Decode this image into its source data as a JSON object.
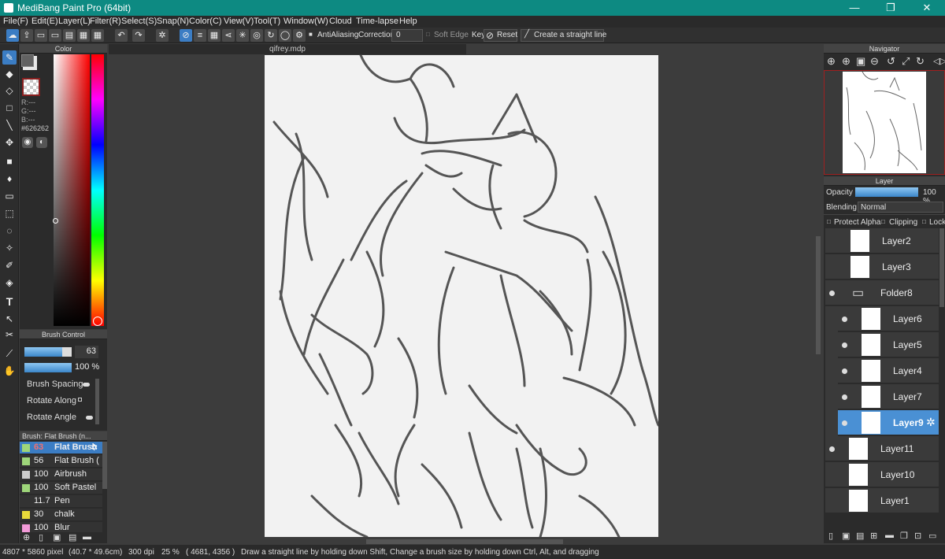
{
  "window": {
    "title": "MediBang Paint Pro (64bit)",
    "minimize": "—",
    "maximize": "❐",
    "close": "✕"
  },
  "menu": [
    "File(F)",
    "Edit(E)",
    "Layer(L)",
    "Filter(R)",
    "Select(S)",
    "Snap(N)",
    "Color(C)",
    "View(V)",
    "Tool(T)",
    "Window(W)",
    "Cloud",
    "Time-lapse",
    "Help"
  ],
  "toolbar": {
    "antialiasing": "AntiAliasing",
    "correction_label": "Correction",
    "correction_value": "0",
    "soft_edge": "Soft Edge",
    "key": "Key",
    "reset": "Reset",
    "straight_line": "Create a straight line"
  },
  "color_panel": {
    "title": "Color",
    "r": "R:---",
    "g": "G:---",
    "b": "B:---",
    "hex": "#626262",
    "main_color": "#626262"
  },
  "brush_control": {
    "title": "Brush Control",
    "size": "63",
    "opacity": "100 %",
    "spacing": "Brush Spacing",
    "rotate_along": "Rotate Along",
    "rotate_angle": "Rotate Angle"
  },
  "brush_list": {
    "title": "Brush: Flat Brush (n...",
    "items": [
      {
        "size": "63",
        "name": "Flat Brush",
        "color": "#9ed67a"
      },
      {
        "size": "56",
        "name": "Flat Brush (",
        "color": "#9ed67a"
      },
      {
        "size": "100",
        "name": "Airbrush",
        "color": "#cccccc"
      },
      {
        "size": "100",
        "name": "Soft Pastel",
        "color": "#9ed67a"
      },
      {
        "size": "11.7",
        "name": "Pen",
        "color": "#333333"
      },
      {
        "size": "30",
        "name": "chalk",
        "color": "#e8d93a"
      },
      {
        "size": "100",
        "name": "Blur",
        "color": "#f29ad8"
      }
    ]
  },
  "document": {
    "tab": "qifrey.mdp"
  },
  "navigator": {
    "title": "Navigator"
  },
  "layer_panel": {
    "title": "Layer",
    "opacity_label": "Opacity",
    "opacity_value": "100 %",
    "opacity_fraction": 1.0,
    "blending_label": "Blending",
    "blending_value": "Normal",
    "protect_alpha": "Protect Alpha",
    "clipping": "Clipping",
    "lock": "Lock",
    "layers": [
      {
        "name": "Layer2",
        "visible": false,
        "indent": 0,
        "selected": false
      },
      {
        "name": "Layer3",
        "visible": false,
        "indent": 0,
        "selected": false
      },
      {
        "name": "Folder8",
        "visible": true,
        "indent": 0,
        "selected": false,
        "folder": true
      },
      {
        "name": "Layer6",
        "visible": true,
        "indent": 1,
        "selected": false
      },
      {
        "name": "Layer5",
        "visible": true,
        "indent": 1,
        "selected": false
      },
      {
        "name": "Layer4",
        "visible": true,
        "indent": 1,
        "selected": false
      },
      {
        "name": "Layer7",
        "visible": true,
        "indent": 1,
        "selected": false
      },
      {
        "name": "Layer9",
        "visible": true,
        "indent": 1,
        "selected": true
      },
      {
        "name": "Layer11",
        "visible": true,
        "indent": 0,
        "selected": false
      },
      {
        "name": "Layer10",
        "visible": false,
        "indent": 0,
        "selected": false
      },
      {
        "name": "Layer1",
        "visible": false,
        "indent": 0,
        "selected": false
      }
    ]
  },
  "status": {
    "size": "4807 * 5860 pixel",
    "cm": "(40.7 * 49.6cm)",
    "dpi": "300 dpi",
    "zoom": "25 %",
    "coords": "( 4681, 4356 )",
    "hint": "Draw a straight line by holding down Shift, Change a brush size by holding down Ctrl, Alt, and dragging"
  }
}
